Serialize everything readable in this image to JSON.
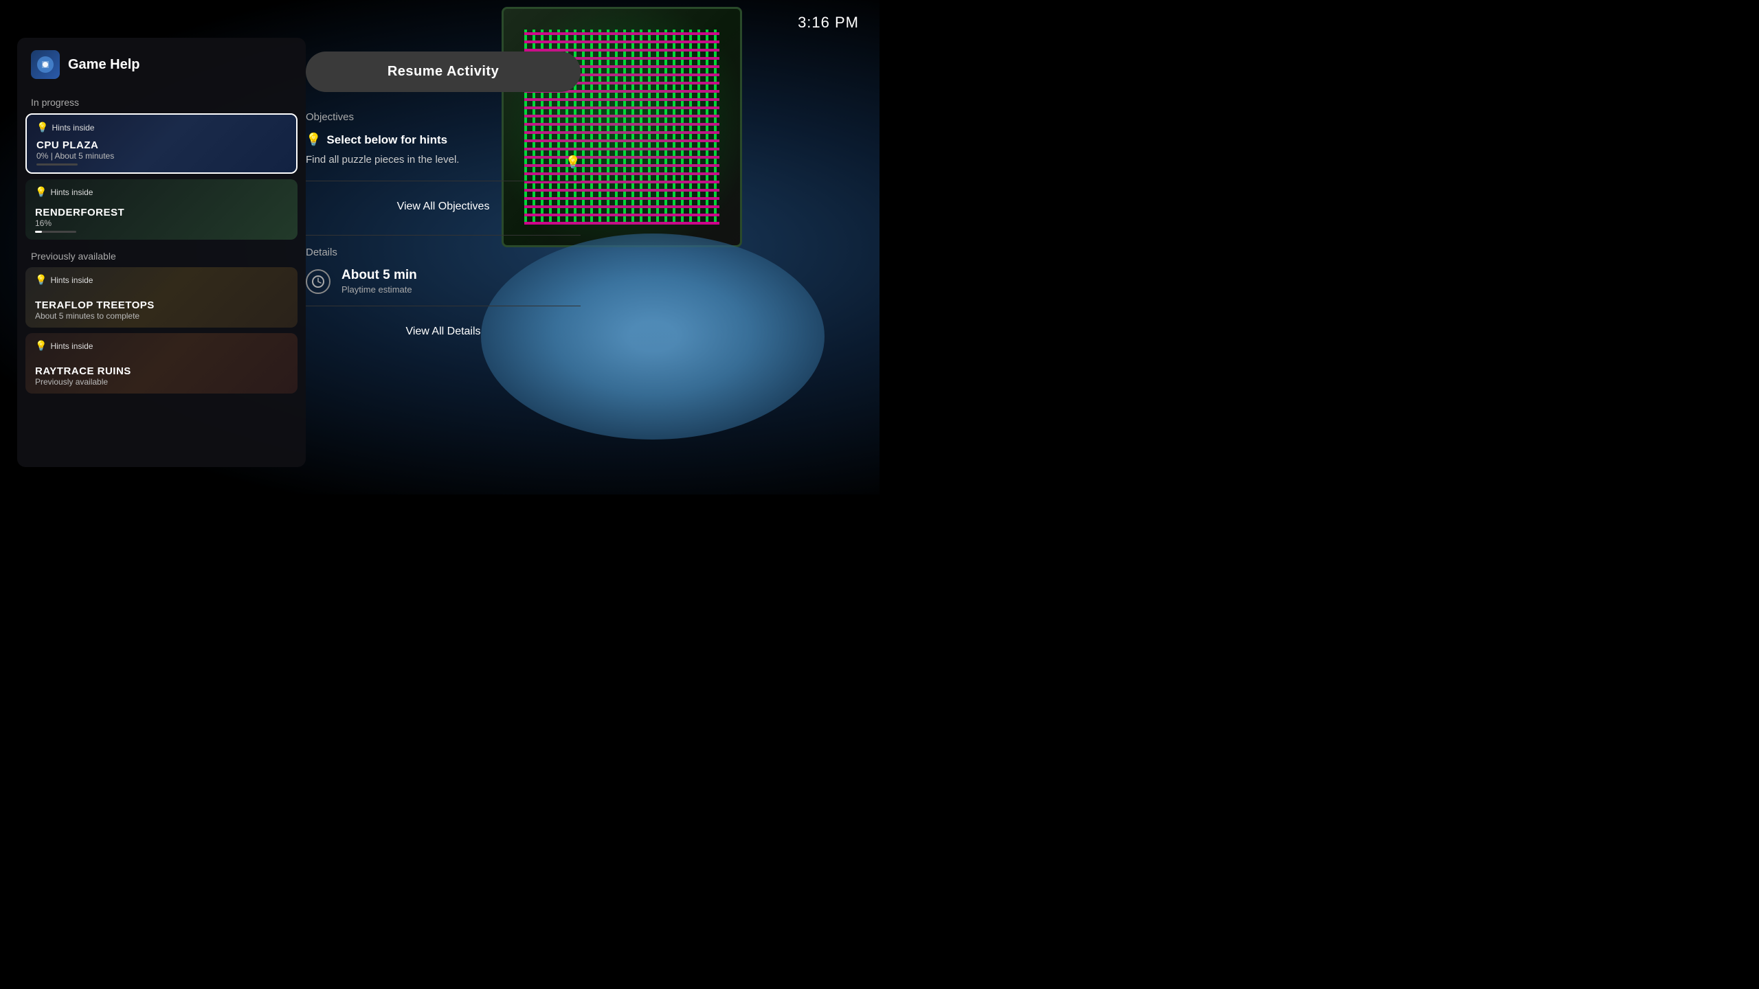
{
  "time": "3:16 PM",
  "panel": {
    "title": "Game Help",
    "in_progress_label": "In progress",
    "previously_available_label": "Previously available",
    "in_progress_items": [
      {
        "id": "cpu-plaza",
        "hints_label": "Hints inside",
        "name": "CPU PLAZA",
        "progress_text": "0%",
        "separator": "|",
        "detail": "About 5 minutes",
        "progress_pct": 0,
        "selected": true,
        "bg": "cpu"
      },
      {
        "id": "renderforest",
        "hints_label": "Hints inside",
        "name": "RENDERFOREST",
        "progress_text": "16%",
        "detail": "",
        "progress_pct": 16,
        "selected": false,
        "bg": "render"
      }
    ],
    "previously_items": [
      {
        "id": "teraflop-treetops",
        "hints_label": "Hints inside",
        "name": "TERAFLOP TREETOPS",
        "detail": "About 5 minutes to complete",
        "bg": "tera"
      },
      {
        "id": "raytrace-ruins",
        "hints_label": "Hints inside",
        "name": "RAYTRACE RUINS",
        "detail": "Previously available",
        "bg": "ray"
      }
    ]
  },
  "right": {
    "resume_button": "Resume Activity",
    "objectives_label": "Objectives",
    "objective_title": "Select below for hints",
    "objective_desc": "Find all puzzle pieces in the level.",
    "view_objectives_btn": "View All Objectives",
    "details_label": "Details",
    "playtime_amount": "About 5 min",
    "playtime_label": "Playtime estimate",
    "view_details_btn": "View All Details"
  }
}
